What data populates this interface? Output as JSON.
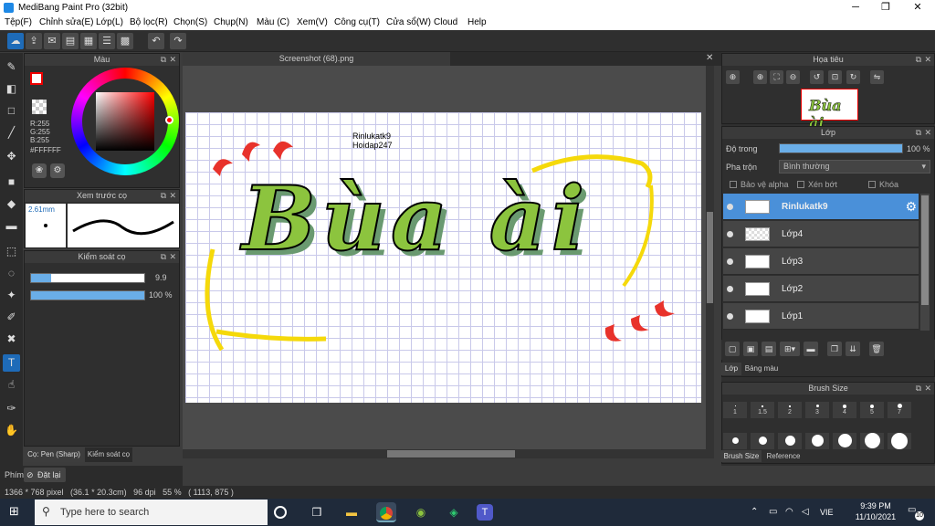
{
  "window": {
    "title": "MediBang Paint Pro (32bit)"
  },
  "menu": [
    "Tệp(F)",
    "Chỉnh sửa(E)",
    "Lớp(L)",
    "Bộ lọc(R)",
    "Chọn(S)",
    "Chụp(N)",
    "Màu (C)",
    "Xem(V)",
    "Công cụ(T)",
    "Cửa sổ(W)",
    "Cloud",
    "Help"
  ],
  "color_panel": {
    "title": "Màu",
    "r": "R:255",
    "g": "G:255",
    "b": "B:255",
    "hex": "#FFFFFF"
  },
  "brush_preview": {
    "title": "Xem trước cọ",
    "size": "2.61mm"
  },
  "brush_control": {
    "title": "Kiểm soát cọ",
    "size_value": "9.9",
    "opacity_value": "100 %",
    "size_fraction": 0.18,
    "opacity_fraction": 1.0
  },
  "left_tabs": {
    "pen": "Cọ: Pen (Sharp)",
    "control": "Kiểm soát cọ"
  },
  "bottom_left": {
    "phim": "Phím",
    "reset": "Đặt lại"
  },
  "canvas": {
    "tab": "Screenshot (68).png",
    "text1": "Rinlukatk9",
    "text2": "Hoidap247",
    "art_text": "Bùa ài"
  },
  "navigator": {
    "title": "Họa tiêu"
  },
  "layer_panel": {
    "title": "Lớp",
    "opacity_label": "Độ trong",
    "opacity_value": "100 %",
    "blend_label": "Pha trộn",
    "blend_value": "Bình thường",
    "protect_alpha": "Bảo vệ alpha",
    "clip": "Xén bớt",
    "lock": "Khóa",
    "layers": [
      "Rinlukatk9",
      "Lớp4",
      "Lớp3",
      "Lớp2",
      "Lớp1"
    ],
    "tab_layer": "Lớp",
    "tab_board": "Bảng màu"
  },
  "brush_size": {
    "title": "Brush Size",
    "labels": [
      "1",
      "1.5",
      "2",
      "3",
      "4",
      "5",
      "7"
    ],
    "tab1": "Brush Size",
    "tab2": "Reference"
  },
  "status": {
    "text": "1366 * 768 pixel   (36.1 * 20.3cm)   96 dpi   55 %   ( 1113, 875 )"
  },
  "taskbar": {
    "search": "Type here to search",
    "lang": "VIE",
    "time": "9:39 PM",
    "date": "11/10/2021",
    "notif": "10"
  }
}
